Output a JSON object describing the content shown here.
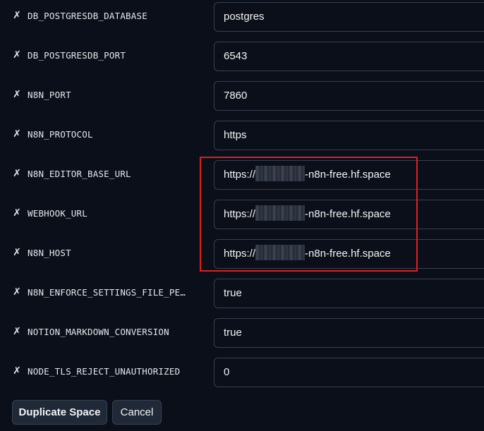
{
  "remove_icon_glyph": "✗",
  "variables": [
    {
      "name": "DB_POSTGRESDB_DATABASE",
      "value": "postgres"
    },
    {
      "name": "DB_POSTGRESDB_PORT",
      "value": "6543"
    },
    {
      "name": "N8N_PORT",
      "value": "7860"
    },
    {
      "name": "N8N_PROTOCOL",
      "value": "https"
    },
    {
      "name": "N8N_EDITOR_BASE_URL",
      "value_prefix": "https://",
      "value_suffix": "-n8n-free.hf.space"
    },
    {
      "name": "WEBHOOK_URL",
      "value_prefix": "https://",
      "value_suffix": "-n8n-free.hf.space"
    },
    {
      "name": "N8N_HOST",
      "value_prefix": "https://",
      "value_suffix": "-n8n-free.hf.space"
    },
    {
      "name": "N8N_ENFORCE_SETTINGS_FILE_PE…",
      "value": "true"
    },
    {
      "name": "NOTION_MARKDOWN_CONVERSION",
      "value": "true"
    },
    {
      "name": "NODE_TLS_REJECT_UNAUTHORIZED",
      "value": "0"
    }
  ],
  "buttons": {
    "duplicate_label": "Duplicate Space",
    "cancel_label": "Cancel"
  },
  "colors": {
    "background": "#0b0f19",
    "field_border": "#374151",
    "highlight": "#e0201e",
    "button_bg": "#1f2937"
  },
  "icons": {
    "remove": "remove-variable-icon"
  }
}
